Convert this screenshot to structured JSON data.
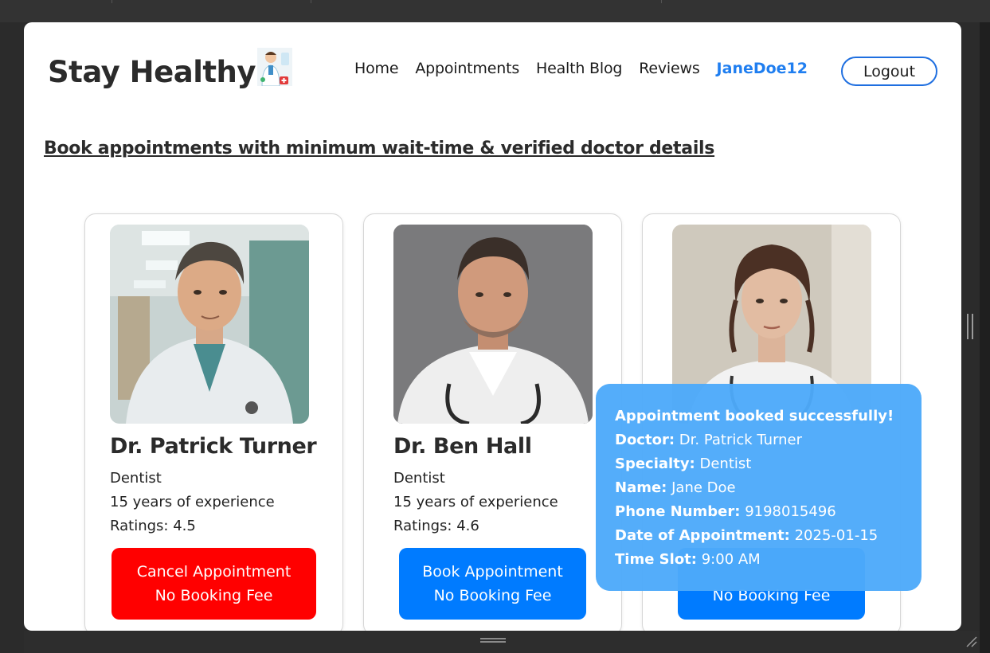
{
  "brand": {
    "title": "Stay Healthy",
    "icon": "doctor-logo-icon"
  },
  "nav": {
    "links": [
      "Home",
      "Appointments",
      "Health Blog",
      "Reviews"
    ],
    "username": "JaneDoe12",
    "logout_label": "Logout"
  },
  "headline": "Book appointments with minimum wait-time & verified doctor details",
  "doctors": [
    {
      "name": "Dr. Patrick Turner",
      "specialty": "Dentist",
      "experience": "15 years of experience",
      "rating": "Ratings: 4.5",
      "button_line1": "Cancel Appointment",
      "button_line2": "No Booking Fee",
      "button_color": "#ff0000"
    },
    {
      "name": "Dr. Ben Hall",
      "specialty": "Dentist",
      "experience": "15 years of experience",
      "rating": "Ratings: 4.6",
      "button_line1": "Book Appointment",
      "button_line2": "No Booking Fee",
      "button_color": "#007bff"
    },
    {
      "button_line2": "No Booking Fee",
      "button_color": "#007bff"
    }
  ],
  "toast": {
    "title": "Appointment booked successfully!",
    "doctor_label": "Doctor:",
    "doctor_value": "Dr. Patrick Turner",
    "specialty_label": "Specialty:",
    "specialty_value": "Dentist",
    "name_label": "Name:",
    "name_value": "Jane Doe",
    "phone_label": "Phone Number:",
    "phone_value": "9198015496",
    "date_label": "Date of Appointment:",
    "date_value": "2025-01-15",
    "slot_label": "Time Slot:",
    "slot_value": "9:00 AM"
  },
  "colors": {
    "accent": "#1f7ef0",
    "toast": "#4daafa"
  }
}
